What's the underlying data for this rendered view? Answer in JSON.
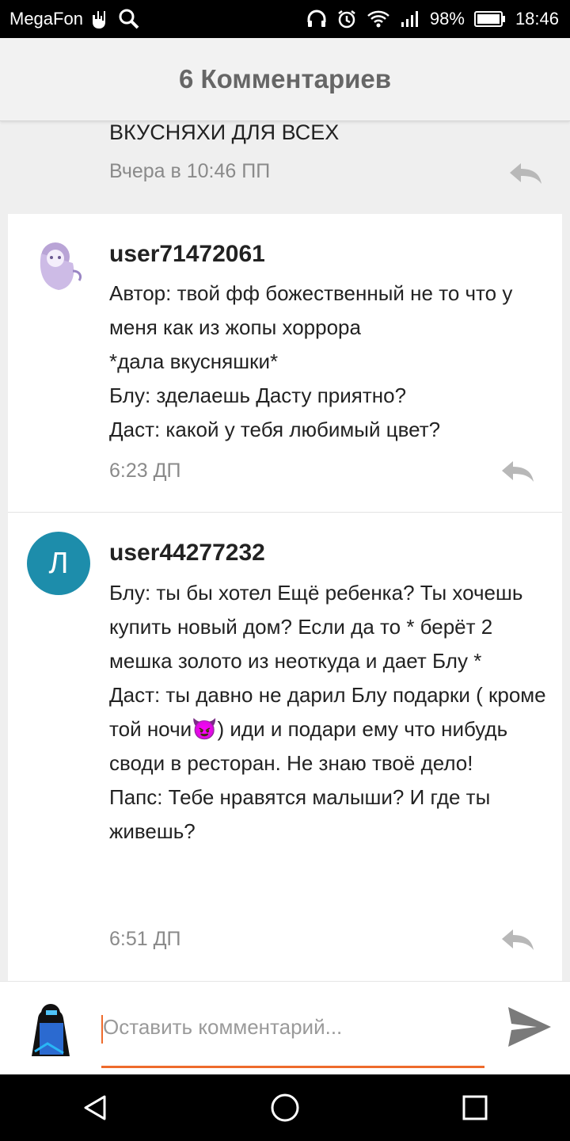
{
  "statusbar": {
    "carrier": "MegaFon",
    "battery": "98%",
    "time": "18:46"
  },
  "header": {
    "title": "6 Комментариев"
  },
  "previous_comment": {
    "text": "ВКУСНЯХИ ДЛЯ ВСЕХ",
    "time": "Вчера в 10:46 ПП"
  },
  "comments": [
    {
      "username": "user71472061",
      "lines": [
        "Автор: твой фф божественный не то что у меня как из жопы хоррора",
        "*дала вкусняшки*",
        "Блу: зделаешь Дасту приятно?",
        "Даст: какой у тебя любимый цвет?"
      ],
      "time": "6:23 ДП"
    },
    {
      "avatar_letter": "Л",
      "username": "user44277232",
      "lines": [
        "Блу: ты бы хотел Ещё ребенка? Ты хочешь купить новый дом? Если да то * берёт 2 мешка золото из неоткуда и дает Блу *",
        "Даст: ты давно не дарил Блу подарки ( кроме той ночи😈) иди и подари ему что нибудь своди в ресторан. Не знаю твоё дело!",
        "Папс: Тебе нравятся малыши? И где ты живешь?"
      ],
      "time": "6:51 ДП"
    }
  ],
  "composer": {
    "placeholder": "Оставить комментарий..."
  },
  "colors": {
    "accent": "#ee6b2c",
    "avatar_teal": "#1d8dab"
  }
}
